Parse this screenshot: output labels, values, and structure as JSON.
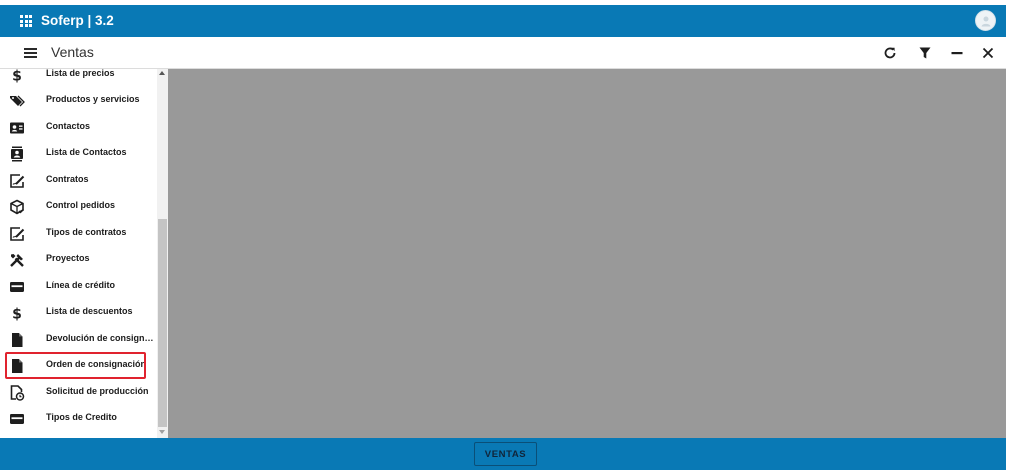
{
  "app": {
    "title": "Soferp | 3.2"
  },
  "header": {
    "module_title": "Ventas"
  },
  "sidebar": {
    "items": [
      {
        "label": "Lista de precios",
        "icon": "dollar-icon"
      },
      {
        "label": "Productos y servicios",
        "icon": "tags-icon"
      },
      {
        "label": "Contactos",
        "icon": "contact-card-icon"
      },
      {
        "label": "Lista de Contactos",
        "icon": "contacts-book-icon"
      },
      {
        "label": "Contratos",
        "icon": "contract-sign-icon"
      },
      {
        "label": "Control pedidos",
        "icon": "package-check-icon"
      },
      {
        "label": "Tipos de contratos",
        "icon": "contract-sign-icon"
      },
      {
        "label": "Proyectos",
        "icon": "tools-icon"
      },
      {
        "label": "Línea de crédito",
        "icon": "credit-card-icon"
      },
      {
        "label": "Lista de descuentos",
        "icon": "dollar-icon"
      },
      {
        "label": "Devolución de consignación",
        "icon": "document-icon"
      },
      {
        "label": "Orden de consignación",
        "icon": "document-icon"
      },
      {
        "label": "Solicitud de producción",
        "icon": "document-clock-icon"
      },
      {
        "label": "Tipos de Credito",
        "icon": "credit-card-icon"
      }
    ],
    "highlighted_index": 11
  },
  "footer": {
    "tab_label": "VENTAS"
  },
  "colors": {
    "brand": "#0979b5",
    "content_bg": "#999999",
    "highlight": "#e0232e"
  }
}
